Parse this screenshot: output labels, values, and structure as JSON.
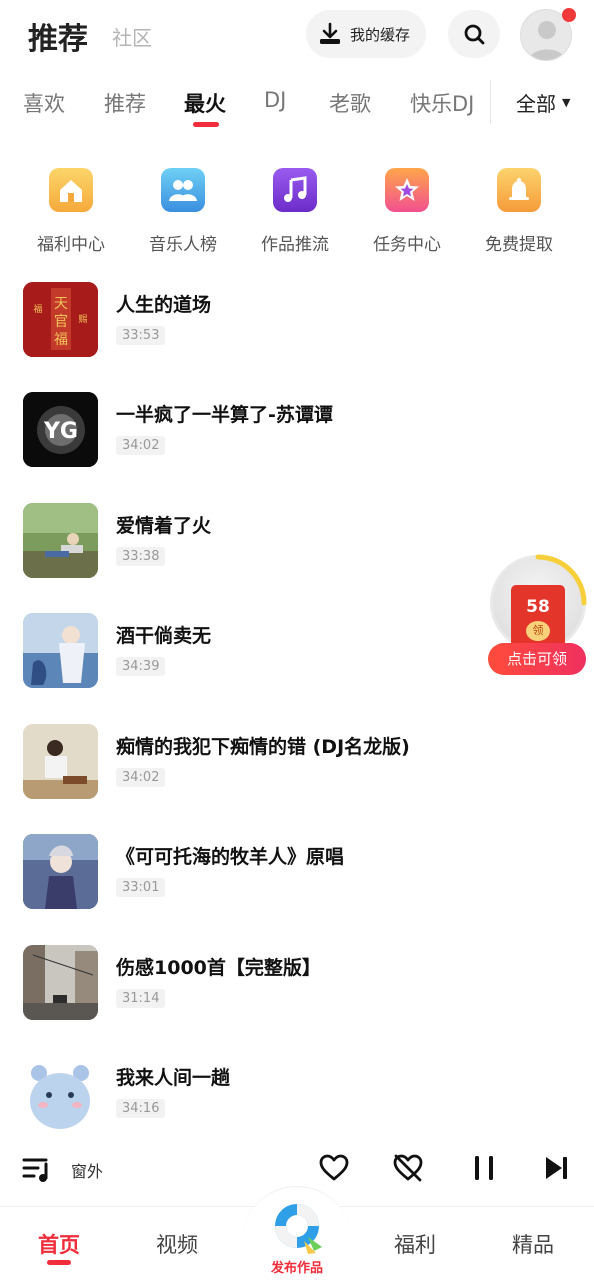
{
  "header": {
    "title": "推荐",
    "subtitle": "社区",
    "cache_label": "我的缓存"
  },
  "tabs": [
    {
      "label": "喜欢"
    },
    {
      "label": "推荐"
    },
    {
      "label": "最火"
    },
    {
      "label": "DJ"
    },
    {
      "label": "老歌"
    },
    {
      "label": "快乐DJ"
    }
  ],
  "all_label": "全部",
  "shortcuts": [
    {
      "label": "福利中心",
      "icon": "home-icon",
      "color": "#f9c24a"
    },
    {
      "label": "音乐人榜",
      "icon": "users-icon",
      "color": "#4cb3ea"
    },
    {
      "label": "作品推流",
      "icon": "music-note-icon",
      "color": "#7a3ed6"
    },
    {
      "label": "任务中心",
      "icon": "star-icon",
      "color": "#f45fa5"
    },
    {
      "label": "免费提取",
      "icon": "bell-icon",
      "color": "#f7b84a"
    }
  ],
  "songs": [
    {
      "title": "人生的道场",
      "duration": "33:53"
    },
    {
      "title": "一半疯了一半算了-苏谭谭",
      "duration": "34:02"
    },
    {
      "title": "爱情着了火",
      "duration": "33:38"
    },
    {
      "title": "酒干倘卖无",
      "duration": "34:39"
    },
    {
      "title": "痴情的我犯下痴情的错 (DJ名龙版)",
      "duration": "34:02"
    },
    {
      "title": "《可可托海的牧羊人》原唱",
      "duration": "33:01"
    },
    {
      "title": "伤感1000首【完整版】",
      "duration": "31:14"
    },
    {
      "title": "我来人间一趟",
      "duration": "34:16"
    }
  ],
  "reward": {
    "count": "58",
    "coin_label": "领",
    "button": "点击可领"
  },
  "player": {
    "float_label": "窗外"
  },
  "nav": {
    "home": "首页",
    "video": "视频",
    "publish": "发布作品",
    "welfare": "福利",
    "premium": "精品"
  },
  "colors": {
    "accent": "#ef2d3b"
  }
}
